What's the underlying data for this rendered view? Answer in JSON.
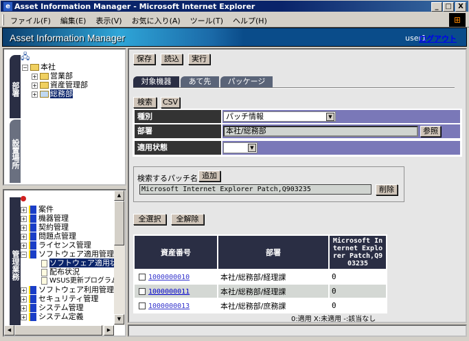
{
  "window": {
    "title": "Asset Information Manager - Microsoft Internet Explorer",
    "min": "_",
    "max": "□",
    "close": "X"
  },
  "menu": [
    "ファイル(F)",
    "編集(E)",
    "表示(V)",
    "お気に入り(A)",
    "ツール(T)",
    "ヘルプ(H)"
  ],
  "header": {
    "app_title": "Asset Information Manager",
    "user": "user1",
    "logout": "ログアウト"
  },
  "left_top": {
    "tabs": [
      "部署",
      "設置場所"
    ],
    "tree": [
      {
        "label": "本社",
        "level": 0,
        "expanded": true
      },
      {
        "label": "営業部",
        "level": 1
      },
      {
        "label": "資産管理部",
        "level": 1
      },
      {
        "label": "総務部",
        "level": 1,
        "selected": true
      }
    ]
  },
  "left_bottom": {
    "tab": "管理業務",
    "tree": [
      {
        "label": "案件",
        "type": "book"
      },
      {
        "label": "機器管理",
        "type": "book"
      },
      {
        "label": "契約管理",
        "type": "book"
      },
      {
        "label": "問題点管理",
        "type": "book"
      },
      {
        "label": "ライセンス管理",
        "type": "book"
      },
      {
        "label": "ソフトウェア適用管理",
        "type": "book",
        "expanded": true
      },
      {
        "label": "ソフトウェア適用状況",
        "type": "doc",
        "selected": true
      },
      {
        "label": "配布状況",
        "type": "doc"
      },
      {
        "label": "WSUS更新プログラム管理",
        "type": "doc"
      },
      {
        "label": "ソフトウェア利用管理",
        "type": "book"
      },
      {
        "label": "セキュリティ管理",
        "type": "book"
      },
      {
        "label": "システム管理",
        "type": "book"
      },
      {
        "label": "システム定義",
        "type": "book"
      }
    ]
  },
  "toolbar": {
    "save": "保存",
    "load": "読込",
    "run": "実行"
  },
  "tabs": [
    "対象機器",
    "あて先",
    "パッケージ"
  ],
  "search": {
    "search": "検索",
    "csv": "CSV"
  },
  "form": {
    "type_label": "種別",
    "type_value": "パッチ情報",
    "dept_label": "部署",
    "dept_value": "本社/総務部",
    "browse": "参照",
    "status_label": "適用状態",
    "status_value": ""
  },
  "patch": {
    "label": "検索するパッチ名",
    "add": "追加",
    "value": "Microsoft Internet Explorer Patch,Q903235",
    "delete": "削除"
  },
  "select": {
    "all": "全選択",
    "none": "全解除"
  },
  "table": {
    "headers": [
      "資産番号",
      "部署",
      "Microsoft Internet Explorer Patch,Q903235"
    ],
    "rows": [
      {
        "id": "1000000010",
        "dept": "本社/総務部/経理課",
        "status": "0"
      },
      {
        "id": "1000000011",
        "dept": "本社/総務部/経理課",
        "status": "0"
      },
      {
        "id": "1000000013",
        "dept": "本社/総務部/庶務課",
        "status": "0"
      }
    ]
  },
  "legend": "0:適用 X:未適用 -:該当なし",
  "colors": {
    "title": "#0a246a",
    "form_label": "#333333",
    "form_value": "#7a78b8",
    "table_header": "#2a2e44",
    "active_tab": "#2a2e44",
    "inactive_tab": "#5a6478"
  }
}
